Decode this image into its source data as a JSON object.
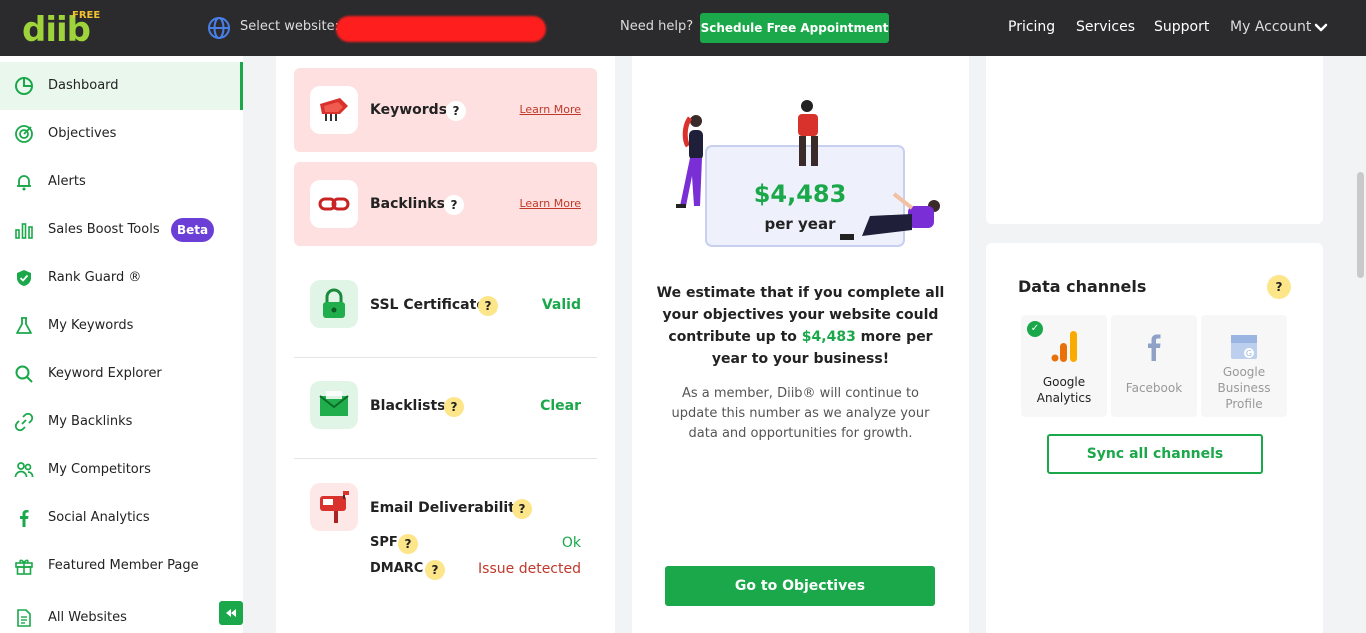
{
  "topbar": {
    "logo_text": "diib",
    "logo_badge": "FREE",
    "select_label": "Select website:",
    "help_label": "Need help?",
    "appointment_button": "Schedule Free Appointment",
    "nav": [
      "Pricing",
      "Services",
      "Support",
      "My Account"
    ]
  },
  "sidebar": {
    "items": [
      {
        "label": "Dashboard",
        "icon": "dashboard-icon",
        "active": true
      },
      {
        "label": "Objectives",
        "icon": "target-icon"
      },
      {
        "label": "Alerts",
        "icon": "bell-icon"
      },
      {
        "label": "Sales Boost Tools",
        "icon": "bar-chart-icon",
        "badge": "Beta"
      },
      {
        "label": "Rank Guard ®",
        "icon": "shield-icon"
      },
      {
        "label": "My Keywords",
        "icon": "flask-icon"
      },
      {
        "label": "Keyword Explorer",
        "icon": "search-icon"
      },
      {
        "label": "My Backlinks",
        "icon": "link-icon"
      },
      {
        "label": "My Competitors",
        "icon": "users-icon"
      },
      {
        "label": "Social Analytics",
        "icon": "facebook-icon"
      },
      {
        "label": "Featured Member Page",
        "icon": "gift-icon"
      },
      {
        "label": "All Websites",
        "icon": "document-icon"
      }
    ]
  },
  "checks": {
    "keywords": {
      "title": "Keywords",
      "q": "?",
      "link": "Learn More"
    },
    "backlinks": {
      "title": "Backlinks",
      "q": "?",
      "link": "Learn More"
    },
    "ssl": {
      "title": "SSL Certificate",
      "q": "?",
      "status": "Valid"
    },
    "blacklists": {
      "title": "Blacklists",
      "q": "?",
      "status": "Clear"
    },
    "email": {
      "title": "Email Deliverability",
      "q": "?",
      "spf_label": "SPF",
      "spf_value": "Ok",
      "dmarc_label": "DMARC",
      "dmarc_value": "Issue detected"
    }
  },
  "estimate": {
    "amount": "$4,483",
    "period": "per year",
    "text_before": "We estimate that if you complete all your objectives your website could contribute up to ",
    "text_amount": "$4,483",
    "text_after": " more per year to your business!",
    "member_text": "As a member, Diib® will continue to update this number as we analyze your data and opportunities for growth.",
    "button": "Go to Objectives"
  },
  "data_channels": {
    "title": "Data channels",
    "q": "?",
    "channels": [
      {
        "label_line1": "Google",
        "label_line2": "Analytics",
        "label_line3": "",
        "active": true
      },
      {
        "label_line1": "Facebook",
        "label_line2": "",
        "label_line3": "",
        "active": false
      },
      {
        "label_line1": "Google",
        "label_line2": "Business",
        "label_line3": "Profile",
        "active": false
      }
    ],
    "sync_button": "Sync all channels"
  },
  "colors": {
    "brand_green": "#1aa84a",
    "beta_purple": "#6b3fd6",
    "alert_red": "#c0392b",
    "card_pink": "#fde0df"
  }
}
